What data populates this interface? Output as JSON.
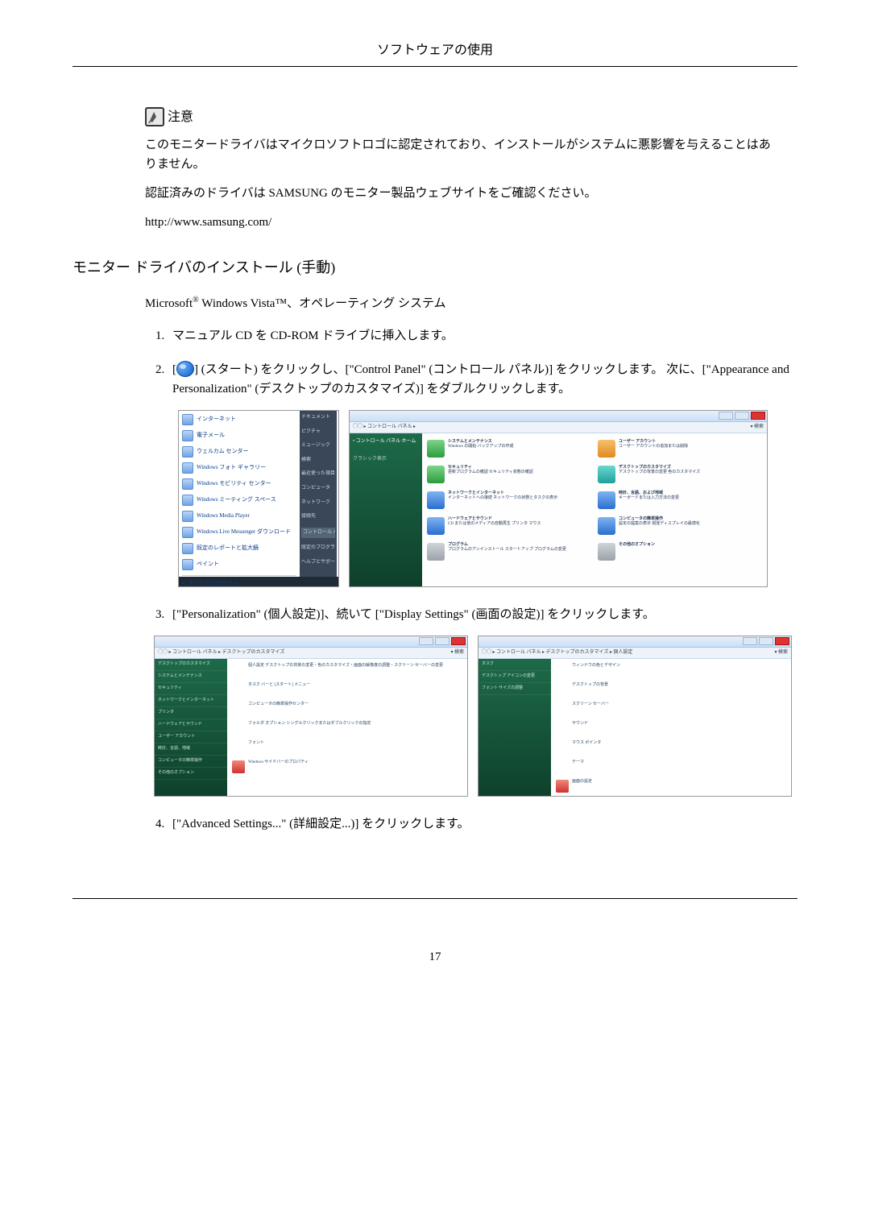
{
  "header": {
    "title": "ソフトウェアの使用"
  },
  "note": {
    "label": "注意",
    "line1": "このモニタードライバはマイクロソフトロゴに認定されており、インストールがシステムに悪影響を与えることはありません。",
    "line2": "認証済みのドライバは SAMSUNG のモニター製品ウェブサイトをご確認ください。",
    "url": "http://www.samsung.com/"
  },
  "section": {
    "title": "モニター ドライバのインストール (手動)"
  },
  "os_line": {
    "prefix": "Microsoft",
    "reg": "®",
    "mid": " Windows Vista™、オペレーティング システム"
  },
  "steps": {
    "s1": "マニュアル CD を CD-ROM ドライブに挿入します。",
    "s2_a": "[",
    "s2_b": "] (スタート) をクリックし、[\"Control Panel\" (コントロール パネル)] をクリックします。 次に、[\"Appearance and Personalization\" (デスクトップのカスタマイズ)] をダブルクリックします。",
    "s3": "[\"Personalization\" (個人設定)]、続いて [\"Display Settings\" (画面の設定)] をクリックします。",
    "s4": "[\"Advanced Settings...\" (詳細設定...)] をクリックします。"
  },
  "start_menu": {
    "items": [
      "インターネット",
      "電子メール",
      "ウェルカム センター",
      "Windows フォト ギャラリー",
      "Windows モビリティ センター",
      "Windows ミーティング スペース",
      "Windows Media Player",
      "Windows Live Messenger ダウンロード",
      "既定のレポートと拡大鏡",
      "ペイント"
    ],
    "all": "すべてのプログラム",
    "search": "検索の開始",
    "right": [
      "ドキュメント",
      "ピクチャ",
      "ミュージック",
      "検索",
      "最近使った項目",
      "コンピュータ",
      "ネットワーク",
      "接続先",
      "コントロール パネル",
      "既定のプログラム",
      "ヘルプとサポート"
    ]
  },
  "control_panel": {
    "address": "コントロール パネル",
    "sidebar": "コントロール パネル ホーム",
    "items_left": [
      {
        "t": "システムとメンテナンス",
        "s": "Windows の開始 バックアップの作成"
      },
      {
        "t": "セキュリティ",
        "s": "更新プログラムの確認 セキュリティ状態の確認"
      },
      {
        "t": "ネットワークとインターネット",
        "s": "インターネットへの接続 ネットワークの状態とタスクの表示"
      },
      {
        "t": "ハードウェアとサウンド",
        "s": "CD または他のメディアの自動再生 プリンタ マウス"
      },
      {
        "t": "プログラム",
        "s": "プログラムのアンインストール スタートアップ プログラムの変更"
      }
    ],
    "items_right": [
      {
        "t": "ユーザー アカウント",
        "s": "ユーザー アカウントの追加または削除"
      },
      {
        "t": "デスクトップのカスタマイズ",
        "s": "デスクトップの背景の変更 色のカスタマイズ"
      },
      {
        "t": "時計、言語、および地域",
        "s": "キーボードまたは入力方法の変更"
      },
      {
        "t": "コンピュータの簡単操作",
        "s": "設定の提案の表示 視覚ディスプレイの最適化"
      },
      {
        "t": "その他のオプション",
        "s": ""
      }
    ]
  },
  "personalization": {
    "address": "コントロール パネル ▸ デスクトップのカスタマイズ",
    "left_items": [
      "デスクトップのカスタマイズ",
      "システムとメンテナンス",
      "セキュリティ",
      "ネットワークとインターネット",
      "プリンタ",
      "ハードウェアとサウンド",
      "ユーザー アカウント",
      "時計、言語、地域",
      "コンピュータの簡単操作",
      "その他のオプション"
    ],
    "right_items": [
      "個人設定 デスクトップの背景の変更・色のカスタマイズ・画面の解像度の調整・スクリーン セーバーの変更",
      "タスク バーと [スタート] メニュー",
      "コンピュータの簡単操作センター",
      "フォルダ オプション シングルクリックまたはダブルクリックの指定",
      "フォント",
      "Windows サイドバーのプロパティ"
    ]
  },
  "personalization_detail": {
    "address": "コントロール パネル ▸ デスクトップのカスタマイズ ▸ 個人設定",
    "items": [
      "ウィンドウの色とデザイン",
      "デスクトップの背景",
      "スクリーン セーバー",
      "サウンド",
      "マウス ポインタ",
      "テーマ",
      "画面の設定"
    ]
  },
  "page_number": "17"
}
